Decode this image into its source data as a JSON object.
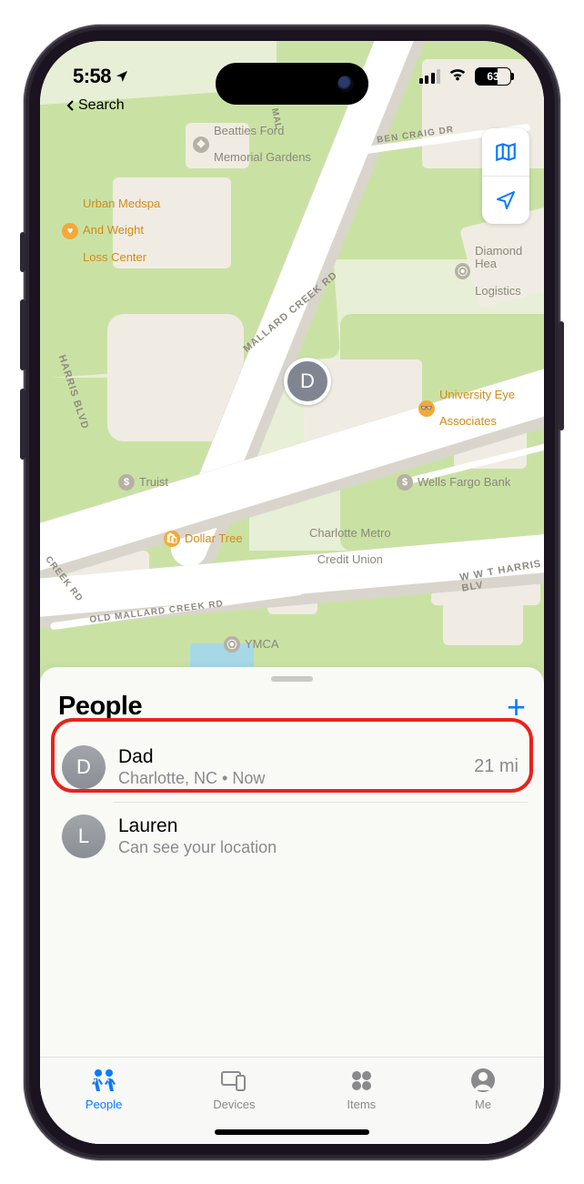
{
  "status": {
    "time": "5:58",
    "battery": "63",
    "breadcrumb": "Search"
  },
  "map": {
    "roads": {
      "mallard_creek": "MALLARD CREEK RD",
      "harris_blvd": "HARRIS BLVD",
      "wwt_harris": "W W T HARRIS BLV",
      "old_mallard": "OLD MALLARD CREEK RD",
      "creek_rd": "CREEK RD",
      "ben_craig": "BEN CRAIG DR",
      "mal": "MAL"
    },
    "pois": {
      "beatties": "Beatties Ford\nMemorial Gardens",
      "urban_medspa": "Urban Medspa\nAnd Weight\nLoss Center",
      "diamond": "Diamond Hea\nLogistics",
      "univ_eye": "University Eye\nAssociates",
      "truist": "Truist",
      "wells": "Wells Fargo Bank",
      "dollar": "Dollar Tree",
      "credit_union": "Charlotte Metro\nCredit Union",
      "ymca": "YMCA"
    },
    "pin_initial": "D"
  },
  "sheet": {
    "title": "People",
    "people": [
      {
        "initial": "D",
        "name": "Dad",
        "sub": "Charlotte, NC  •  Now",
        "distance": "21 mi"
      },
      {
        "initial": "L",
        "name": "Lauren",
        "sub": "Can see your location",
        "distance": ""
      }
    ]
  },
  "tabs": {
    "people": "People",
    "devices": "Devices",
    "items": "Items",
    "me": "Me"
  }
}
